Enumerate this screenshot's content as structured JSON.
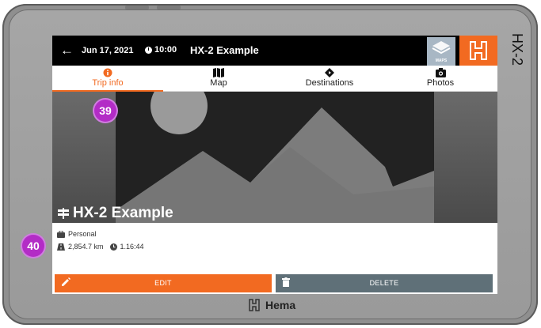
{
  "device": {
    "side_label": "HX-2"
  },
  "header": {
    "back": "←",
    "date": "Jun 17, 2021",
    "time": "10:00",
    "title": "HX-2 Example",
    "maps_label": "MAPS"
  },
  "tabs": [
    {
      "label": "Trip info",
      "icon": "info-icon",
      "active": true
    },
    {
      "label": "Map",
      "icon": "map-icon",
      "active": false
    },
    {
      "label": "Destinations",
      "icon": "directions-icon",
      "active": false
    },
    {
      "label": "Photos",
      "icon": "camera-icon",
      "active": false
    }
  ],
  "trip": {
    "name": "HX-2 Example",
    "category": "Personal",
    "distance": "2,854.7 km",
    "duration": "1.16:44"
  },
  "actions": {
    "edit": "EDIT",
    "delete": "DELETE"
  },
  "callouts": {
    "first": "39",
    "second": "40"
  },
  "brand": {
    "name": "Hema"
  },
  "colors": {
    "accent": "#f26a21",
    "delete": "#5f7078",
    "callout": "#b32cc6",
    "topbar": "#000000"
  }
}
